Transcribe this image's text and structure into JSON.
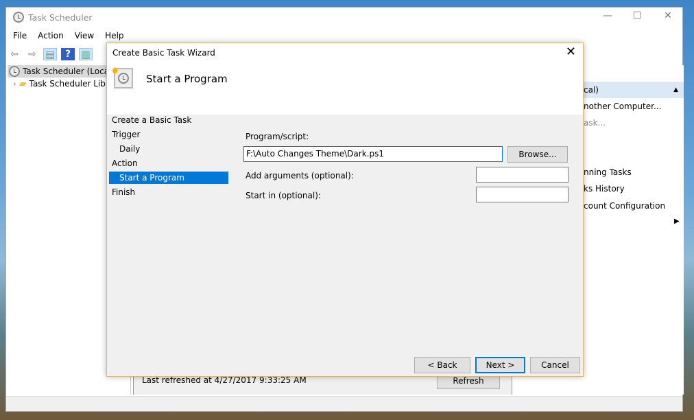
{
  "window": {
    "title": "Task Scheduler",
    "minimize": "—",
    "maximize": "☐",
    "close": "✕"
  },
  "menu": [
    "File",
    "Action",
    "View",
    "Help"
  ],
  "tree": {
    "root": "Task Scheduler (Local)",
    "library": "Task Scheduler Libr"
  },
  "actions": {
    "header": "cal)",
    "items": [
      "nother Computer...",
      "ask...",
      "nning Tasks",
      "ks History",
      "count Configuration"
    ]
  },
  "middle": {
    "last_refreshed": "Last refreshed at 4/27/2017 9:33:25 AM",
    "refresh": "Refresh"
  },
  "wizard": {
    "title": "Create Basic Task Wizard",
    "close": "✕",
    "heading": "Start a Program",
    "steps": [
      "Create a Basic Task",
      "Trigger",
      "Daily",
      "Action",
      "Start a Program",
      "Finish"
    ],
    "program_label": "Program/script:",
    "program_value": "F:\\Auto Changes Theme\\Dark.ps1",
    "browse": "Browse...",
    "args_label": "Add arguments (optional):",
    "args_value": "",
    "startin_label": "Start in (optional):",
    "startin_value": "",
    "back": "< Back",
    "next": "Next >",
    "cancel": "Cancel"
  },
  "colors": {
    "selection": "#0078d7",
    "wizard_border": "#d9b774"
  }
}
